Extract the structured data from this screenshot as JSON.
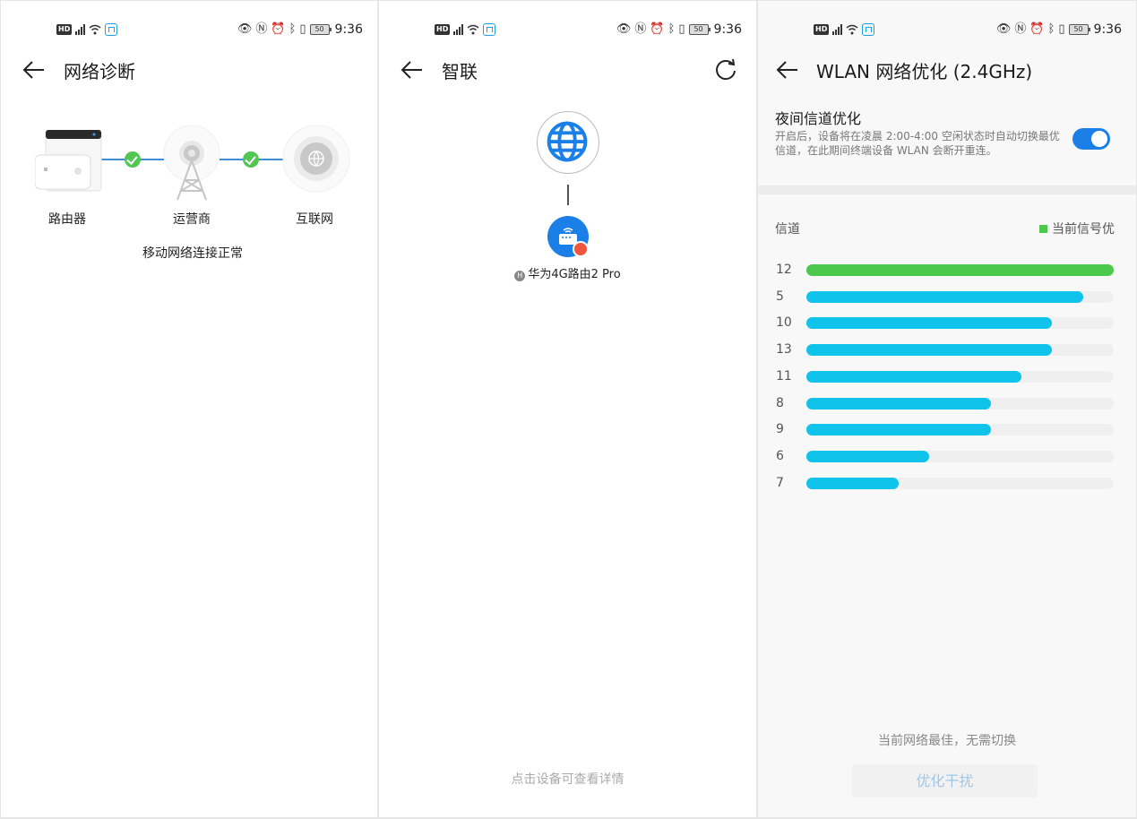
{
  "status_bar": {
    "time": "9:36",
    "battery": "50",
    "network_label": "HD"
  },
  "panel1": {
    "title": "网络诊断",
    "nodes": [
      "路由器",
      "运营商",
      "互联网"
    ],
    "status": "移动网络连接正常"
  },
  "panel2": {
    "title": "智联",
    "device_badge": "H",
    "device_name": "华为4G路由2 Pro",
    "hint": "点击设备可查看详情"
  },
  "panel3": {
    "title": "WLAN 网络优化 (2.4GHz)",
    "night_opt_title": "夜间信道优化",
    "night_opt_desc": "开启后，设备将在凌晨 2:00-4:00 空闲状态时自动切换最优信道，在此期间终端设备 WLAN 会断开重连。",
    "night_opt_enabled": true,
    "channel_header": "信道",
    "legend_label": "当前信号优",
    "best_text": "当前网络最佳，无需切换",
    "button_label": "优化干扰",
    "colors": {
      "current": "#4cc94c",
      "other": "#10c3ea"
    },
    "channels": [
      {
        "channel": "12",
        "quality": 1.0,
        "current": true
      },
      {
        "channel": "5",
        "quality": 0.9,
        "current": false
      },
      {
        "channel": "10",
        "quality": 0.8,
        "current": false
      },
      {
        "channel": "13",
        "quality": 0.8,
        "current": false
      },
      {
        "channel": "11",
        "quality": 0.7,
        "current": false
      },
      {
        "channel": "8",
        "quality": 0.6,
        "current": false
      },
      {
        "channel": "9",
        "quality": 0.6,
        "current": false
      },
      {
        "channel": "6",
        "quality": 0.4,
        "current": false
      },
      {
        "channel": "7",
        "quality": 0.3,
        "current": false
      }
    ]
  }
}
